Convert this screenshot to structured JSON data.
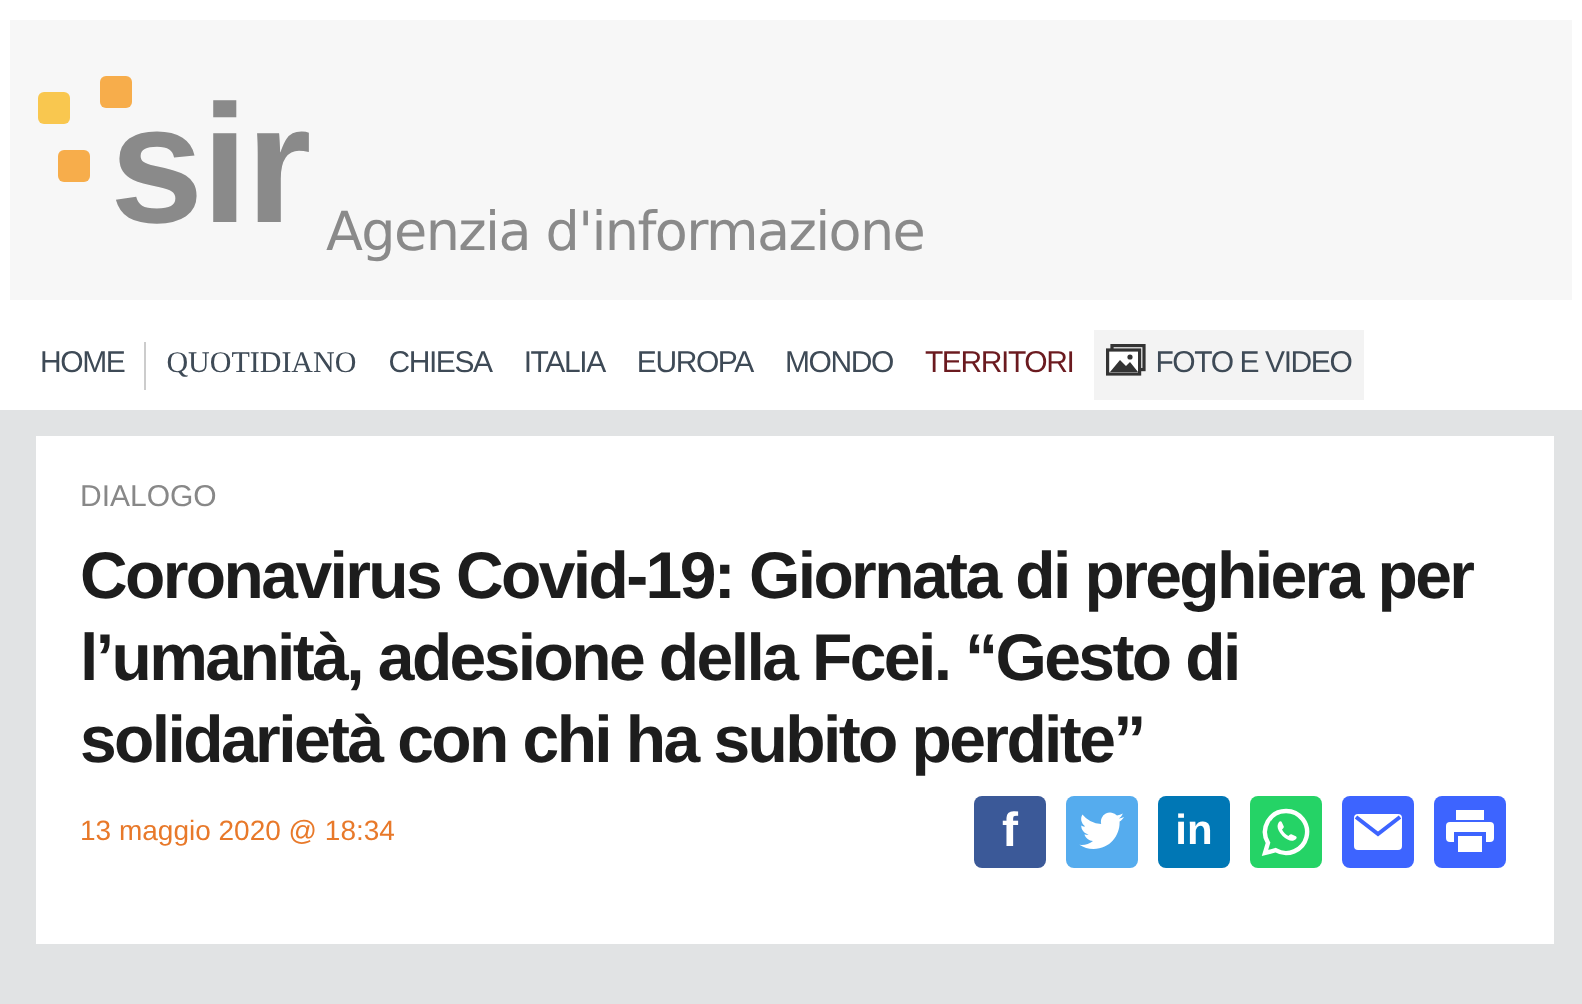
{
  "logo": {
    "mark": "sir",
    "tagline": "Agenzia d'informazione"
  },
  "nav": [
    {
      "label": "HOME",
      "kind": "plain"
    },
    {
      "label": "QUOTIDIANO",
      "kind": "serif"
    },
    {
      "label": "CHIESA",
      "kind": "plain"
    },
    {
      "label": "ITALIA",
      "kind": "plain"
    },
    {
      "label": "EUROPA",
      "kind": "plain"
    },
    {
      "label": "MONDO",
      "kind": "plain"
    },
    {
      "label": "TERRITORI",
      "kind": "region"
    },
    {
      "label": "FOTO E VIDEO",
      "kind": "media"
    }
  ],
  "article": {
    "category": "DIALOGO",
    "title": "Coronavirus Covid-19: Giornata di preghiera per l’umanità, adesione della Fcei. “Gesto di solidarietà con chi ha subito perdite”",
    "date": "13 maggio 2020 @ 18:34"
  },
  "share": [
    {
      "kind": "facebook",
      "glyph": "f",
      "color": "#3b5998"
    },
    {
      "kind": "twitter",
      "color": "#55acee"
    },
    {
      "kind": "linkedin",
      "glyph": "in",
      "color": "#0077b5"
    },
    {
      "kind": "whatsapp",
      "color": "#25d366"
    },
    {
      "kind": "email",
      "color": "#3d64ff"
    },
    {
      "kind": "print",
      "color": "#3d64ff"
    }
  ]
}
